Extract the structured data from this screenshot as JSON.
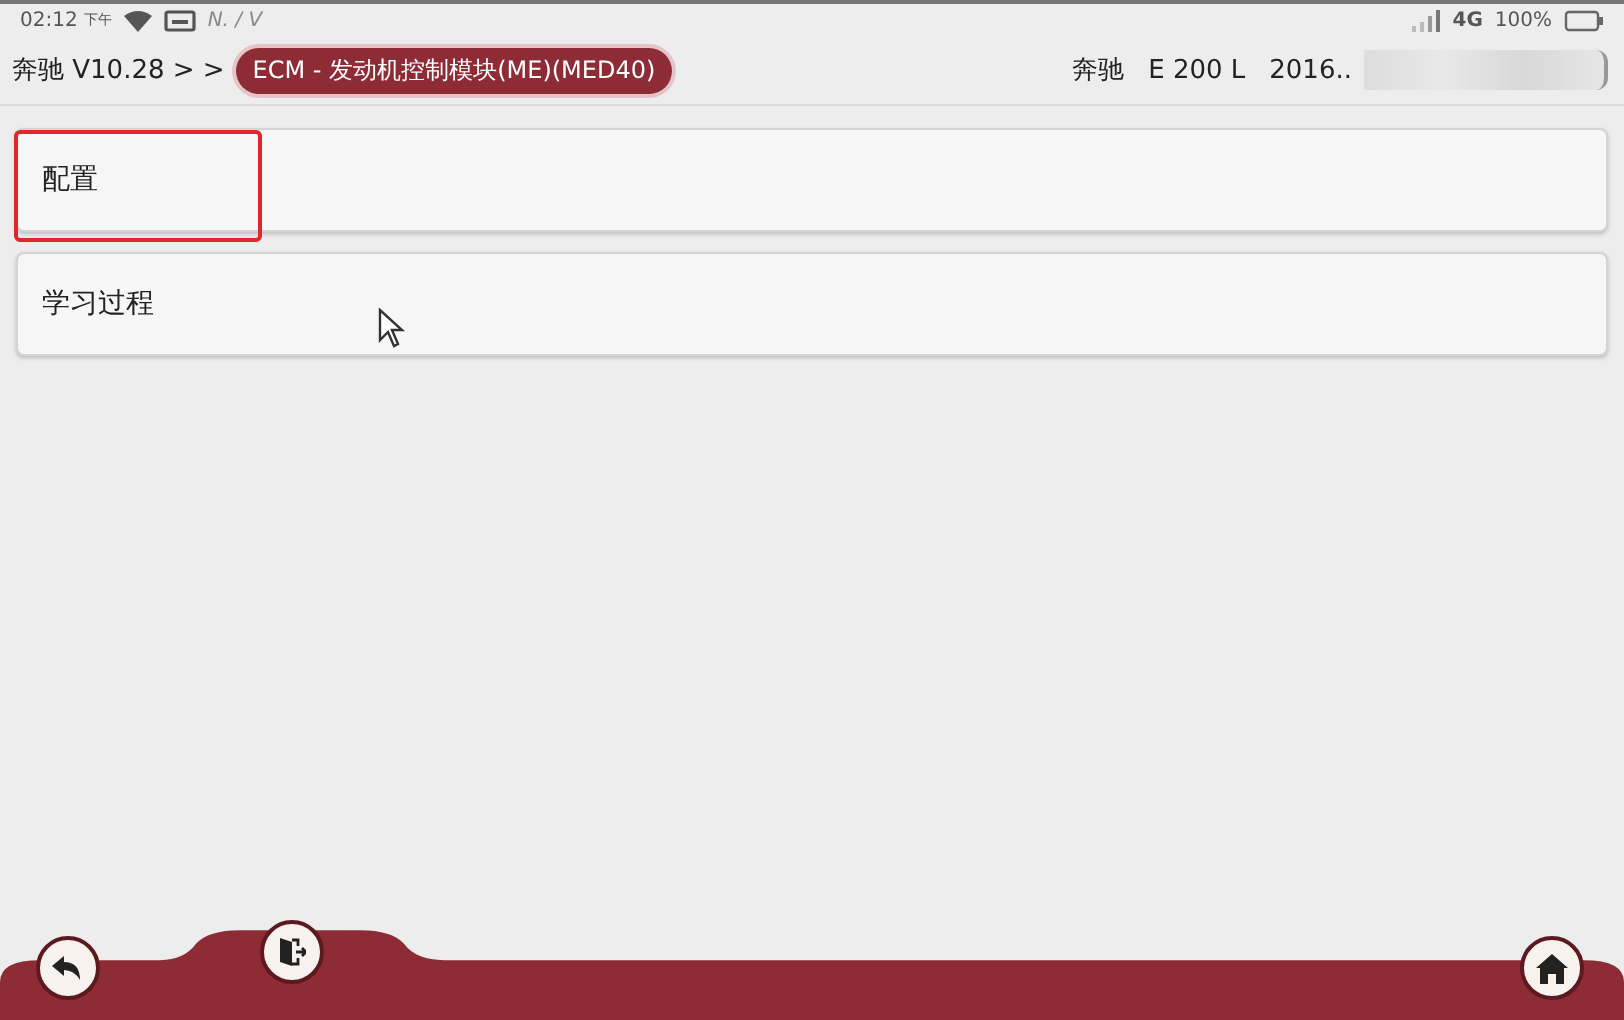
{
  "status_bar": {
    "time": "02:12",
    "ampm": "下午",
    "carrier": "N. / V",
    "network": "4G",
    "battery": "100%"
  },
  "breadcrumb": {
    "root": "奔驰 V10.28 > >",
    "current": "ECM - 发动机控制模块(ME)(MED40)"
  },
  "vehicle": {
    "make": "奔驰",
    "model": "E 200 L",
    "year": "2016.."
  },
  "menu": [
    {
      "label": "配置",
      "highlighted": true
    },
    {
      "label": "学习过程",
      "highlighted": false
    }
  ]
}
